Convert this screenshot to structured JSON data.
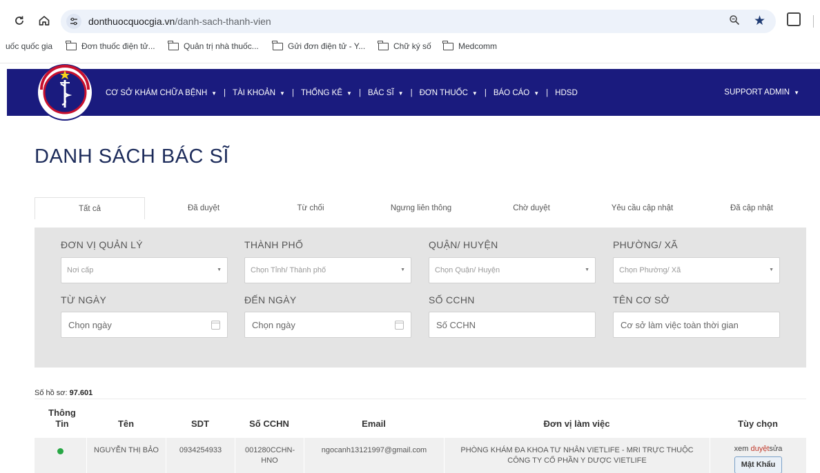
{
  "browser": {
    "url_domain": "donthuocquocgia.vn",
    "url_path": "/danh-sach-thanh-vien",
    "bookmarks": [
      "uốc quốc gia",
      "Đơn thuốc điện tử...",
      "Quản trị nhà thuốc...",
      "Gửi đơn điện tử - Y...",
      "Chữ ký số",
      "Medcomm"
    ]
  },
  "logo": {
    "text_top": "BỘ Y TẾ",
    "text_bottom": "MINISTRY OF HEALTH"
  },
  "nav": {
    "items": [
      "CƠ SỞ KHÁM CHỮA BỆNH",
      "TÀI KHOẢN",
      "THỐNG KÊ",
      "BÁC SĨ",
      "ĐƠN THUỐC",
      "BÁO CÁO",
      "HDSD"
    ],
    "support": "SUPPORT ADMIN"
  },
  "page_title": "DANH SÁCH BÁC SĨ",
  "tabs": [
    "Tất cả",
    "Đã duyệt",
    "Từ chối",
    "Ngưng liên thông",
    "Chờ duyệt",
    "Yêu cầu cập nhật",
    "Đã cập nhật"
  ],
  "filters": {
    "don_vi_label": "ĐƠN VỊ QUẢN LÝ",
    "don_vi_placeholder": "Nơi cấp",
    "thanh_pho_label": "THÀNH PHỐ",
    "thanh_pho_placeholder": "Chọn Tỉnh/ Thành phố",
    "quan_label": "QUẬN/ HUYỆN",
    "quan_placeholder": "Chọn Quận/ Huyện",
    "phuong_label": "PHƯỜNG/ XÃ",
    "phuong_placeholder": "Chọn Phường/ Xã",
    "tu_ngay_label": "TỪ NGÀY",
    "tu_ngay_placeholder": "Chọn ngày",
    "den_ngay_label": "ĐẾN NGÀY",
    "den_ngay_placeholder": "Chọn ngày",
    "cchn_label": "SỐ CCHN",
    "cchn_placeholder": "Số CCHN",
    "co_so_label": "TÊN CƠ SỞ",
    "co_so_placeholder": "Cơ sở làm việc toàn thời gian"
  },
  "record_count": {
    "label": "Số hồ sơ:",
    "value": "97.601"
  },
  "table": {
    "headers": {
      "info": "Thông Tin",
      "name": "Tên",
      "phone": "SDT",
      "cchn": "Số CCHN",
      "email": "Email",
      "workplace": "Đơn vị làm việc",
      "options": "Tùy chọn"
    },
    "rows": [
      {
        "status_color": "#28a745",
        "name": "NGUYỄN THỊ BẢO",
        "phone": "0934254933",
        "cchn": "001280CCHN-HNO",
        "email": "ngocanh13121997@gmail.com",
        "workplace": "PHÒNG KHÁM ĐA KHOA TƯ NHÂN VIETLIFE - MRI TRỰC THUỘC CÔNG TY CỔ PHẦN Y DƯỢC VIETLIFE",
        "action_view": "xem",
        "action_approve": "duyệt",
        "action_edit": "sửa",
        "password_button": "Mật Khẩu"
      }
    ]
  }
}
